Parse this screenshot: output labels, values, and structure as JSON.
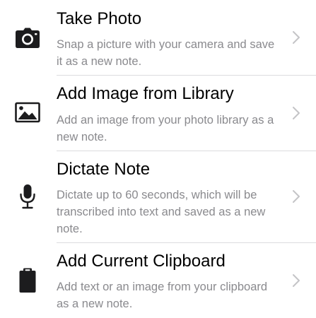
{
  "colors": {
    "title": "#000000",
    "description": "#8a8a8e",
    "chevron": "#c4c4c7",
    "separator": "#dcdcde",
    "icon": "#1c1c1e"
  },
  "items": [
    {
      "title": "Take Photo",
      "description": "Snap a picture with your camera and save it as a new note.",
      "icon": "camera-icon"
    },
    {
      "title": "Add Image from Library",
      "description": "Add an image from your photo library as a new note.",
      "icon": "photo-icon"
    },
    {
      "title": "Dictate Note",
      "description": "Dictate up to 60 seconds, which will be transcribed into text and saved as a new note.",
      "icon": "microphone-icon"
    },
    {
      "title": "Add Current Clipboard",
      "description": "Add text or an image from your clipboard as a new note.",
      "icon": "clipboard-icon"
    }
  ]
}
